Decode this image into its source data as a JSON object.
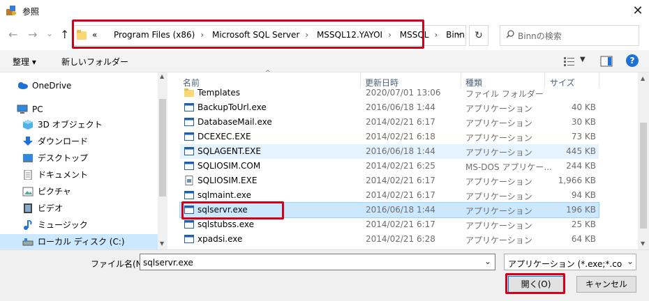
{
  "window": {
    "title": "参照",
    "close_glyph": "✕"
  },
  "nav": {
    "back": "←",
    "forward": "→",
    "recent": "⌄",
    "up": "↑",
    "breadcrumb": [
      "«",
      "Program Files (x86)",
      "Microsoft SQL Server",
      "MSSQL12.YAYOI",
      "MSSQL",
      "Binn"
    ],
    "dropdown": "⌄",
    "refresh": "↻",
    "search_placeholder": "Binnの検索"
  },
  "toolbar": {
    "organize": "整理 ▾",
    "new_folder": "新しいフォルダー",
    "help": "?"
  },
  "sidebar": {
    "items": [
      {
        "label": "OneDrive",
        "icon": "cloud-icon"
      },
      {
        "label": "PC",
        "icon": "computer-icon"
      },
      {
        "label": "3D オブジェクト",
        "icon": "cube-icon"
      },
      {
        "label": "ダウンロード",
        "icon": "download-icon"
      },
      {
        "label": "デスクトップ",
        "icon": "desktop-icon"
      },
      {
        "label": "ドキュメント",
        "icon": "document-icon"
      },
      {
        "label": "ピクチャ",
        "icon": "picture-icon"
      },
      {
        "label": "ビデオ",
        "icon": "video-icon"
      },
      {
        "label": "ミュージック",
        "icon": "music-icon"
      },
      {
        "label": "ローカル ディスク (C:)",
        "icon": "drive-icon"
      }
    ]
  },
  "columns": {
    "name": "名前",
    "date": "更新日時",
    "type": "種類",
    "size": "サイズ"
  },
  "files": [
    {
      "name": "Templates",
      "date": "2020/07/01 13:06",
      "type": "ファイル フォルダー",
      "size": ""
    },
    {
      "name": "BackupToUrl.exe",
      "date": "2016/06/18 1:44",
      "type": "アプリケーション",
      "size": "40 KB"
    },
    {
      "name": "DatabaseMail.exe",
      "date": "2014/02/21 6:17",
      "type": "アプリケーション",
      "size": "30 KB"
    },
    {
      "name": "DCEXEC.EXE",
      "date": "2014/02/21 6:18",
      "type": "アプリケーション",
      "size": "73 KB"
    },
    {
      "name": "SQLAGENT.EXE",
      "date": "2016/06/18 1:44",
      "type": "アプリケーション",
      "size": "445 KB"
    },
    {
      "name": "SQLIOSIM.COM",
      "date": "2014/02/21 6:25",
      "type": "MS-DOS アプリケー...",
      "size": "244 KB"
    },
    {
      "name": "SQLIOSIM.EXE",
      "date": "2014/02/21 6:17",
      "type": "アプリケーション",
      "size": "1,966 KB"
    },
    {
      "name": "sqlmaint.exe",
      "date": "2014/02/21 6:17",
      "type": "アプリケーション",
      "size": "94 KB"
    },
    {
      "name": "sqlservr.exe",
      "date": "2016/06/18 1:44",
      "type": "アプリケーション",
      "size": "196 KB"
    },
    {
      "name": "sqlstubss.exe",
      "date": "2014/02/21 6:17",
      "type": "アプリケーション",
      "size": "25 KB"
    },
    {
      "name": "xpadsi.exe",
      "date": "2014/02/21 6:28",
      "type": "アプリケーション",
      "size": "64 KB"
    }
  ],
  "footer": {
    "filename_label": "ファイル名(N):",
    "filename_value": "sqlservr.exe",
    "filter_value": "アプリケーション (*.exe;*.com;*.icd",
    "open_label": "開く(O)",
    "cancel_label": "キャンセル"
  },
  "colors": {
    "accent": "#0078d7",
    "highlight": "#d0021b",
    "selection": "#cce8ff",
    "hover_row": "#e5f3ff"
  }
}
